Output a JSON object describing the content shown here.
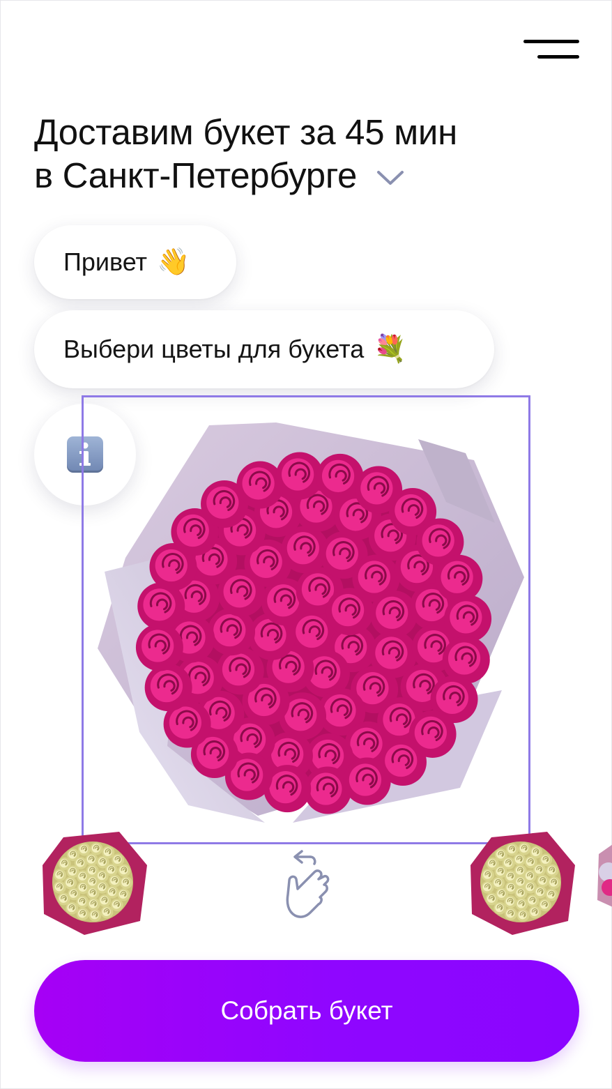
{
  "header": {
    "menu_icon": "hamburger-menu-icon",
    "title_line1": "Доставим букет за 45 мин",
    "title_line2": "в Санкт-Петербурге",
    "city_dropdown_icon": "chevron-down-icon"
  },
  "chat": {
    "greeting": "Привет",
    "greeting_emoji": "👋",
    "prompt": "Выбери цветы для букета",
    "prompt_emoji": "💐",
    "info_icon": "info-icon"
  },
  "carousel": {
    "selected_item": "pink-roses-bouquet",
    "thumbnails": [
      "white-yellow-roses-bouquet",
      "white-yellow-roses-bouquet",
      "bouquet-partial"
    ],
    "swipe_hint_icon": "swipe-left-hand-icon"
  },
  "cta": {
    "label": "Собрать букет"
  },
  "colors": {
    "accent_start": "#a600f5",
    "accent_end": "#8a05ff",
    "selection_border": "#8f7ae6",
    "rose_pink": "#e0137a",
    "wrap_lilac": "#cdbfd6"
  }
}
